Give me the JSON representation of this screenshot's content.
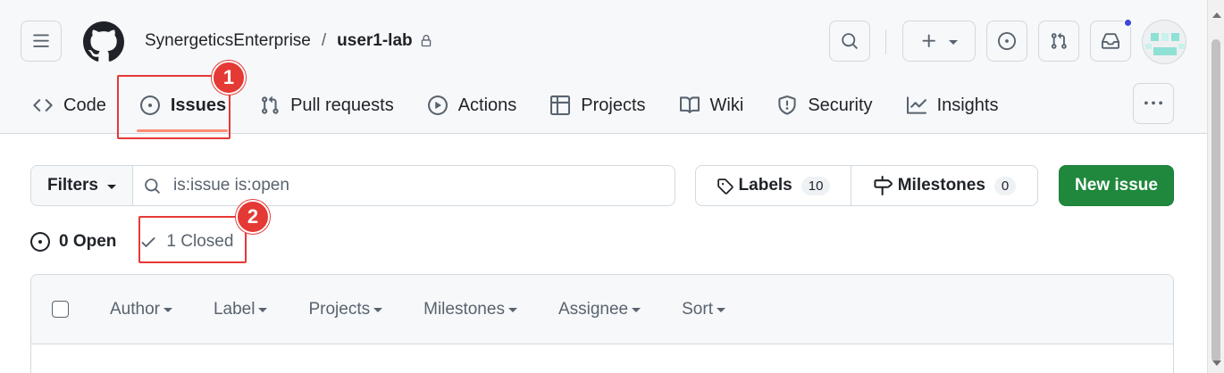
{
  "header": {
    "owner": "SynergeticsEnterprise",
    "separator": "/",
    "repo": "user1-lab"
  },
  "tabs": [
    {
      "label": "Code",
      "icon": "code-icon"
    },
    {
      "label": "Issues",
      "icon": "issue-opened-icon",
      "active": true
    },
    {
      "label": "Pull requests",
      "icon": "git-pull-request-icon"
    },
    {
      "label": "Actions",
      "icon": "play-icon"
    },
    {
      "label": "Projects",
      "icon": "table-icon"
    },
    {
      "label": "Wiki",
      "icon": "book-icon"
    },
    {
      "label": "Security",
      "icon": "shield-icon"
    },
    {
      "label": "Insights",
      "icon": "graph-icon"
    }
  ],
  "toolbar": {
    "filters_label": "Filters",
    "search_value": "is:issue is:open",
    "labels_label": "Labels",
    "labels_count": "10",
    "milestones_label": "Milestones",
    "milestones_count": "0",
    "new_issue_label": "New issue"
  },
  "states": {
    "open": "0 Open",
    "closed": "1 Closed"
  },
  "list_header": {
    "author": "Author",
    "label": "Label",
    "projects": "Projects",
    "milestones": "Milestones",
    "assignee": "Assignee",
    "sort": "Sort"
  },
  "callouts": {
    "one": "1",
    "two": "2"
  },
  "colors": {
    "accent_green": "#1f883d",
    "callout_red": "#e53935",
    "tab_underline": "#fd8c73",
    "notification": "#3d46d6"
  }
}
